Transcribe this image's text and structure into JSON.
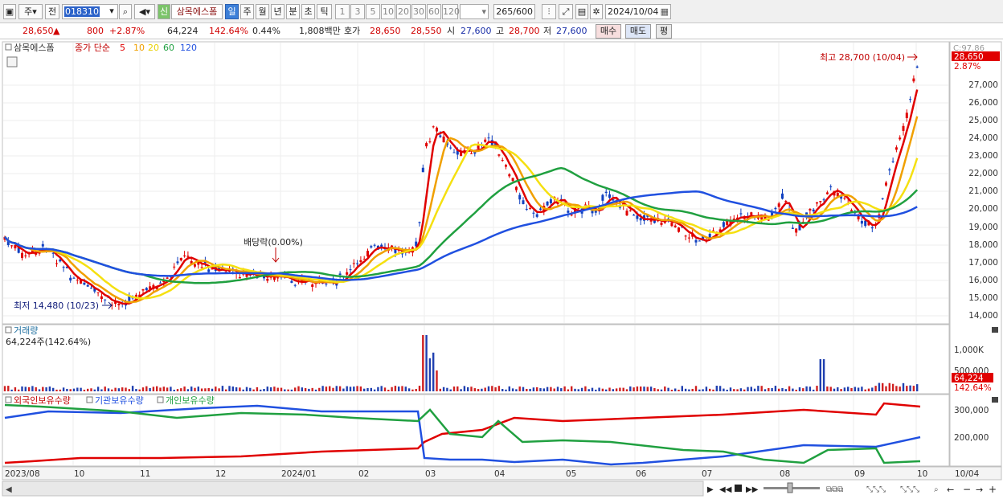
{
  "toolbar": {
    "period_sel": "주",
    "prev": "전",
    "code": "018310",
    "credit": "신",
    "name": "삼목에스폼",
    "periods": [
      "일",
      "주",
      "월",
      "년",
      "분",
      "초",
      "틱"
    ],
    "period_active": "일",
    "minutes": [
      "1",
      "3",
      "5",
      "10",
      "20",
      "30",
      "60",
      "120"
    ],
    "count": "265",
    "count_total": "/600",
    "date": "2024/10/04"
  },
  "info": {
    "price": "28,650",
    "arrow": "▲",
    "change": "800",
    "change_pct": "+2.87%",
    "volume": "64,224",
    "volume_pct": "142.64%",
    "turnover_pct": "0.44%",
    "amount": "1,808백만",
    "quote_label": "호가",
    "ask": "28,650",
    "bid": "28,550",
    "open_label": "시",
    "open": "27,600",
    "high_label": "고",
    "high": "28,700",
    "low_label": "저",
    "low": "27,600",
    "buy": "매수",
    "sell": "매도",
    "avg": "평"
  },
  "price_panel": {
    "stock": "삼목에스폼",
    "ma_label": "종가 단순",
    "ma_periods": [
      "5",
      "10",
      "20",
      "60",
      "120"
    ],
    "ma_colors": [
      "#e00000",
      "#f0a000",
      "#f5e010",
      "#20a040",
      "#2050e0"
    ],
    "high_note": "최고 28,700 (10/04)",
    "low_note": "최저 14,480 (10/23)",
    "dividend": "배당락(0.00%)",
    "cur_pct": "C:97.86",
    "cur_price": "28,650",
    "cur_chg": "2.87%",
    "axis": [
      "27,000",
      "26,000",
      "25,000",
      "24,000",
      "23,000",
      "22,000",
      "21,000",
      "20,000",
      "19,000",
      "18,000",
      "17,000",
      "16,000",
      "15,000",
      "14,000"
    ]
  },
  "volume_panel": {
    "title": "거래량",
    "value": "64,224주(142.64%)",
    "axis": [
      "1,000K",
      "500,000"
    ],
    "cur": "64,224",
    "cur_pct": "142.64%"
  },
  "holding_panel": {
    "legend": [
      "외국인보유수량",
      "기관보유수량",
      "개인보유수량"
    ],
    "colors": [
      "#e00000",
      "#2050e0",
      "#20a040"
    ],
    "axis": [
      "300,000",
      "200,000"
    ]
  },
  "xaxis": {
    "labels": [
      "2023/08",
      "10",
      "11",
      "12",
      "2024/01",
      "02",
      "03",
      "04",
      "05",
      "06",
      "07",
      "08",
      "09",
      "10"
    ],
    "right": "10/04"
  }
}
